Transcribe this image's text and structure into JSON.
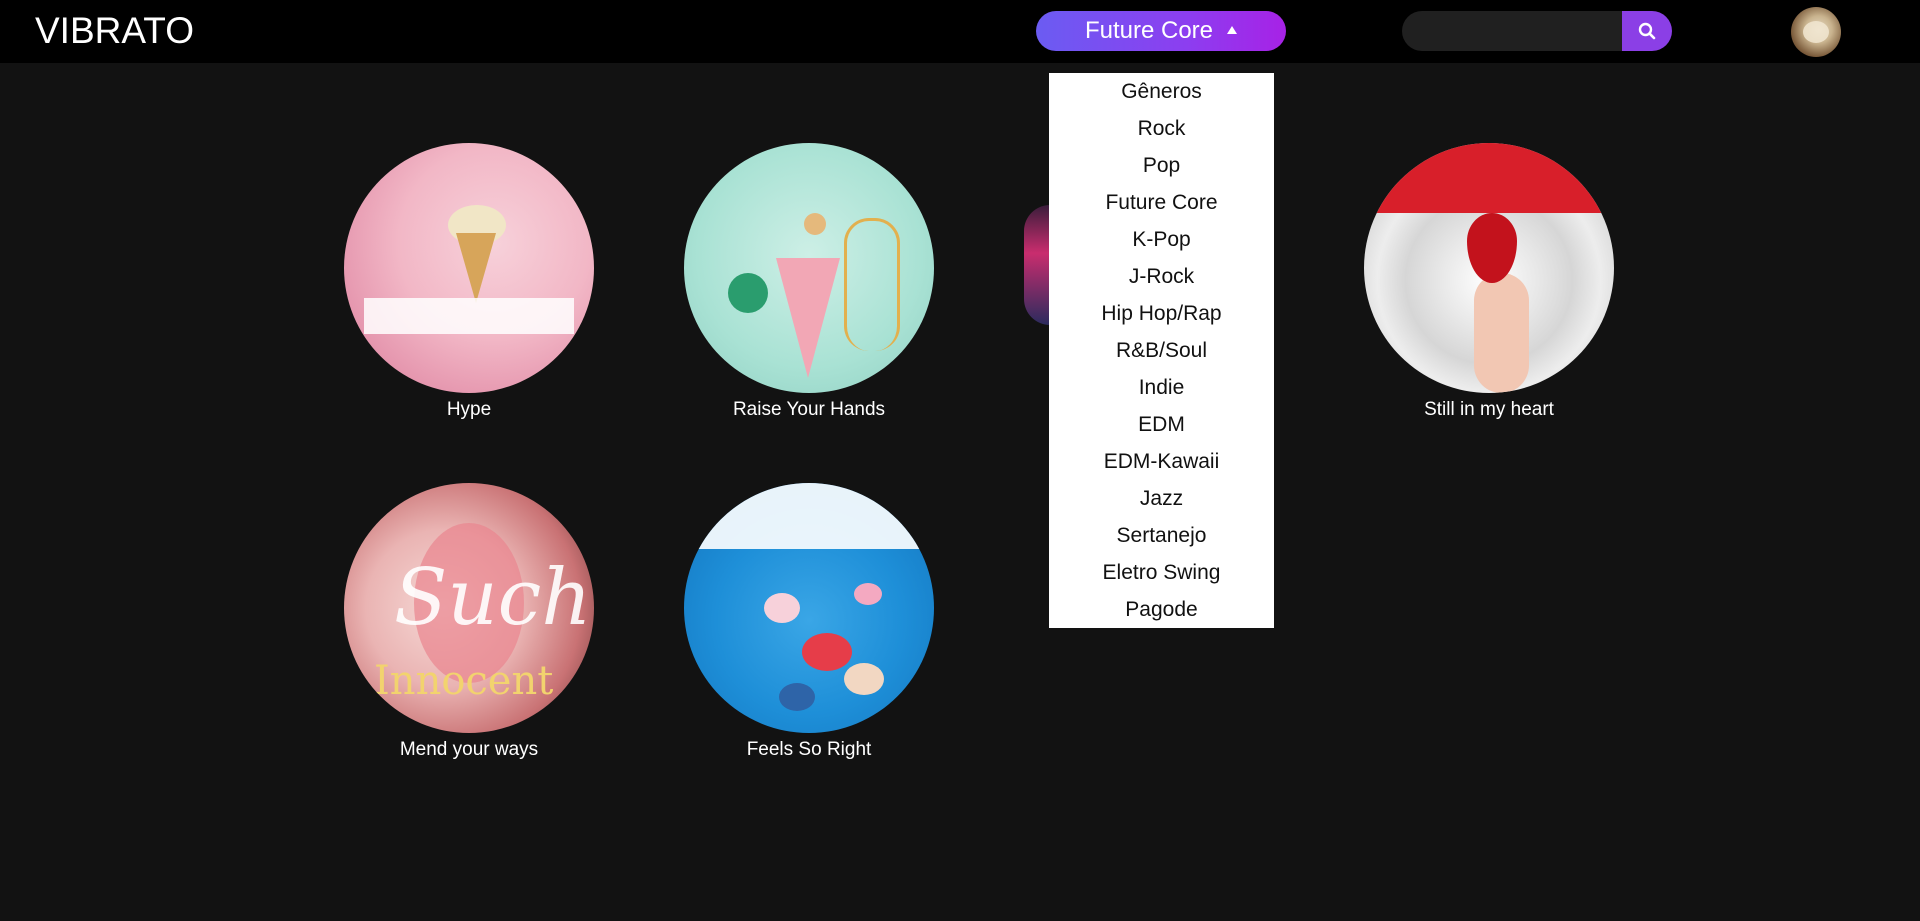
{
  "header": {
    "logo": "VIBRATO",
    "genre_selected": "Future Core",
    "search": {
      "value": "",
      "placeholder": ""
    }
  },
  "dropdown": {
    "items": [
      "Gêneros",
      "Rock",
      "Pop",
      "Future Core",
      "K-Pop",
      "J-Rock",
      "Hip Hop/Rap",
      "R&B/Soul",
      "Indie",
      "EDM",
      "EDM-Kawaii",
      "Jazz",
      "Sertanejo",
      "Eletro Swing",
      "Pagode"
    ]
  },
  "albums": [
    {
      "title": "Hype"
    },
    {
      "title": "Raise Your Hands"
    },
    {
      "title": "Still in my heart"
    },
    {
      "title": "Mend your ways"
    },
    {
      "title": "Feels So Right"
    }
  ],
  "colors": {
    "background": "#121212",
    "topbar": "#000000",
    "accent_start": "#6b5cf2",
    "accent_end": "#a722e6",
    "dropdown_bg": "#ffffff"
  },
  "icons": {
    "caret": "caret-up-icon",
    "search": "search-icon",
    "avatar": "avatar"
  }
}
